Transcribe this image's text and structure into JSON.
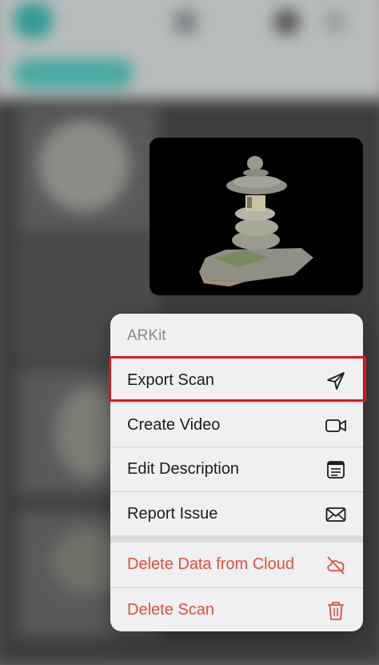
{
  "menu": {
    "title": "ARKit",
    "items": [
      {
        "label": "Export Scan",
        "icon": "send-arrow-icon",
        "destructive": false
      },
      {
        "label": "Create Video",
        "icon": "video-camera-icon",
        "destructive": false
      },
      {
        "label": "Edit Description",
        "icon": "note-text-icon",
        "destructive": false
      },
      {
        "label": "Report Issue",
        "icon": "envelope-icon",
        "destructive": false
      },
      {
        "label": "Delete Data from Cloud",
        "icon": "cloud-slash-icon",
        "destructive": true
      },
      {
        "label": "Delete Scan",
        "icon": "trash-icon",
        "destructive": true
      }
    ]
  },
  "colors": {
    "accent": "#2f9c94",
    "destructive": "#e24f3c",
    "highlight": "#e0151c",
    "menu_bg": "#f0f0f2"
  }
}
